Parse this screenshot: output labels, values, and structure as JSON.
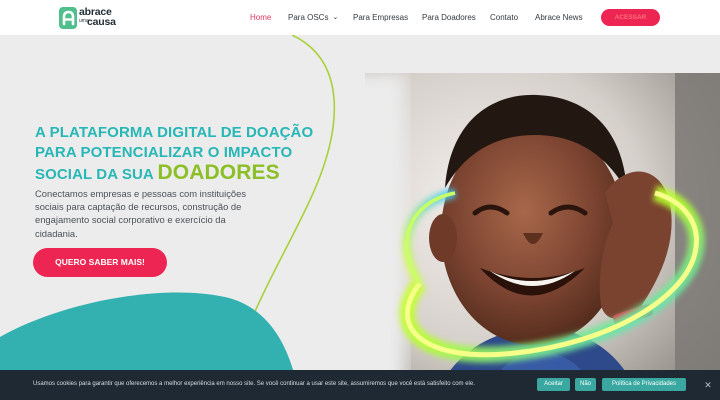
{
  "logo": {
    "word1": "abrace",
    "word2": "uma",
    "word3": "causa",
    "icon": "abrace-a-mark"
  },
  "nav": {
    "home": "Home",
    "osc": "Para OSCs",
    "osc_chevron": "⌄",
    "empresas": "Para Empresas",
    "doadores": "Para Doadores",
    "contato": "Contato",
    "news": "Abrace News",
    "cta": "ACESSAR"
  },
  "hero": {
    "headline_line1": "A PLATAFORMA DIGITAL DE DOAÇÃO",
    "headline_line2": "PARA POTENCIALIZAR O IMPACTO",
    "headline_line3": "SOCIAL DA SUA ",
    "headline_highlight": "DOADORES",
    "subtext": "Conectamos empresas e pessoas com instituições sociais para captação de recursos, construção de engajamento social corporativo e exercício da cidadania.",
    "cta": "QUERO SABER MAIS!"
  },
  "cookie": {
    "text": "Usamos cookies para garantir que oferecemos a melhor experiência em nosso site. Se você continuar a usar este site, assumiremos que você está satisfeito com ele.",
    "accept": "Aceitar",
    "decline": "Não",
    "policy": "Política de Privacidades",
    "close": "✕"
  },
  "colors": {
    "accent_pink": "#ec2552",
    "teal": "#27b7b6",
    "lime": "#8cbf27",
    "cookie_bg": "#1f2933",
    "cookie_button": "#3aa8a0"
  }
}
